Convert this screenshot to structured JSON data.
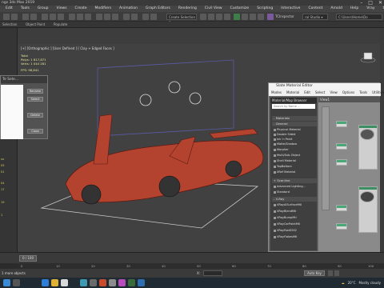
{
  "window": {
    "title": "ngs 3ds Max 2019",
    "controls": [
      "–",
      "□",
      "✕"
    ]
  },
  "menubar": {
    "items": [
      "Edit",
      "Tools",
      "Group",
      "Views",
      "Create",
      "Modifiers",
      "Animation",
      "Graph Editors",
      "Rendering",
      "Civil View",
      "Customize",
      "Scripting",
      "Interactive",
      "Content",
      "Arnold",
      "Help",
      "Vray",
      "tapeTools"
    ]
  },
  "toolbar": {
    "selection_set": "Create Selection Se",
    "tc_label": "TCInspector",
    "workspace": "ral Studio ▾",
    "path": "C:\\Users\\Home\\Do"
  },
  "toolbar2": {
    "items": [
      "Selection",
      "Object Paint",
      "Populate"
    ]
  },
  "viewport": {
    "label": "[+] [Orthographic ] [User Defined ] [ Clay + Edged Faces ]",
    "stats": {
      "header": "Total",
      "polys_label": "Polys:",
      "polys_value": "1 817,871",
      "verts_label": "Verts:",
      "verts_value": "1 044 281",
      "fps_label": "FPS:",
      "fps_value": "98,841"
    }
  },
  "dialog": {
    "title": "Te Sele...",
    "buttons": [
      "Rename",
      "Select",
      "Delete",
      "Close"
    ]
  },
  "left_items": [
    "xu",
    "05",
    "01",
    "04",
    "17",
    "19",
    "1"
  ],
  "material_editor": {
    "title": "Slate Material Editor",
    "menu": [
      "Modes",
      "Material",
      "Edit",
      "Select",
      "View",
      "Options",
      "Tools",
      "Utilities"
    ],
    "browser_header": "Material/Map Browser",
    "search_placeholder": "Search by Name ...",
    "view_header": "View1",
    "groups": [
      {
        "label": "- Materials",
        "items": []
      },
      {
        "label": "- General",
        "items": [
          "Physical Material",
          "Double Sided",
          "Ink 'n Paint",
          "Matte/Shadow",
          "Morpher",
          "Multi/Sub-Object",
          "Shell Material",
          "TopBottom",
          "XRef Material"
        ]
      },
      {
        "label": "+ Scanline",
        "items": [
          "Advanced Lighting...",
          "Standard"
        ]
      },
      {
        "label": "- V-Ray",
        "items": [
          "VRayAlSurfaceMtl",
          "VRayBlendMtl",
          "VRayBumpMtl",
          "VRayCarPaintMtl",
          "VRayFastSSS2",
          "VRayFlakesMtl"
        ]
      }
    ]
  },
  "timeline": {
    "frame": "0 / 100",
    "ticks": [
      "0",
      "10",
      "20",
      "30",
      "40",
      "50",
      "60",
      "70",
      "80",
      "90",
      "100"
    ],
    "x_field": "X:",
    "autokey": "Auto Key"
  },
  "statusbar": {
    "message": "1 more objects"
  },
  "taskbar": {
    "weather": "20°C",
    "weather_desc": "Mostly cloudy",
    "time": ""
  },
  "colors": {
    "car_body": "#b3432f",
    "viewport_bg": "#414141",
    "node_header": "#4aa876",
    "stats_text": "#e8e89a"
  }
}
